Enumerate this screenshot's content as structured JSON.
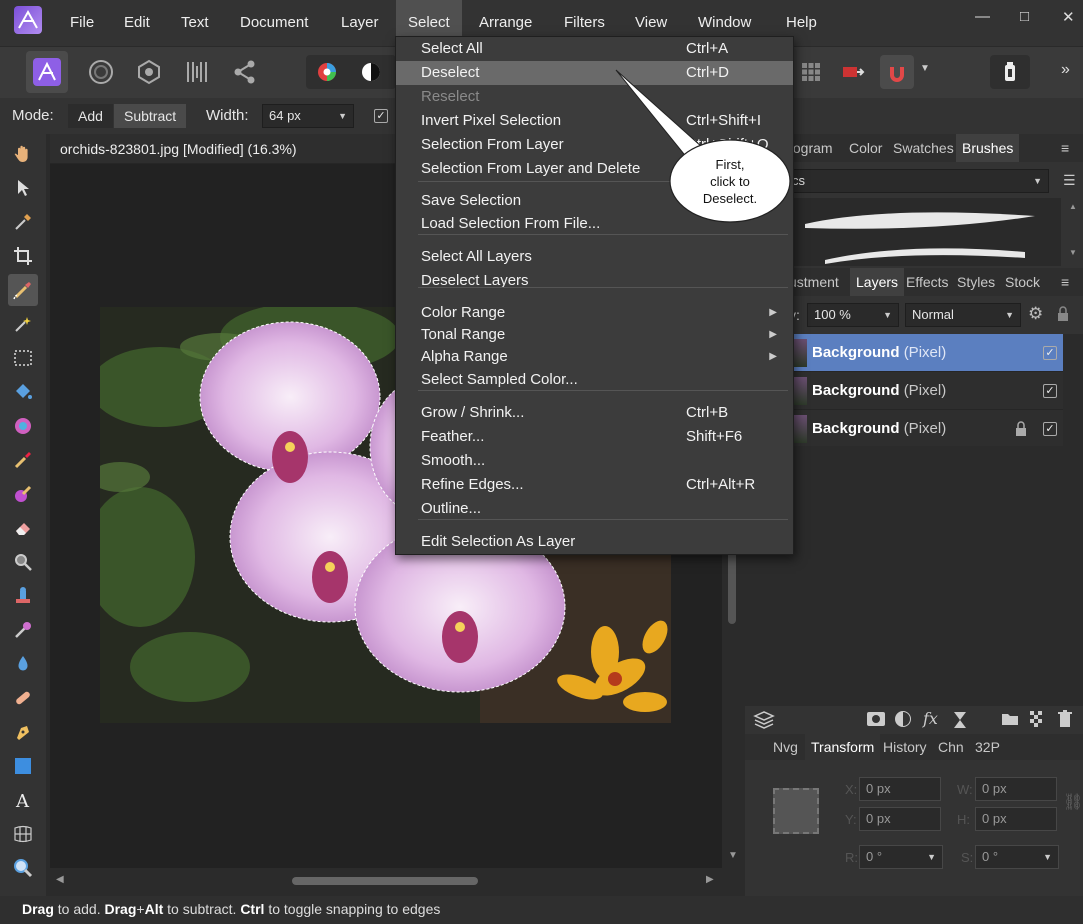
{
  "menubar": {
    "items": [
      "File",
      "Edit",
      "Text",
      "Document",
      "Layer",
      "Select",
      "Arrange",
      "Filters",
      "View",
      "Window",
      "Help"
    ],
    "active": "Select",
    "window_controls": {
      "minimize": "—",
      "maximize": "□",
      "close": "✕"
    }
  },
  "toolbar": {
    "more_label": "»"
  },
  "context_bar": {
    "mode_label": "Mode:",
    "mode_add": "Add",
    "mode_subtract": "Subtract",
    "width_label": "Width:",
    "width_value": "64 px",
    "checkbox_mark": "✓"
  },
  "document": {
    "tab_title": "orchids-823801.jpg [Modified] (16.3%)"
  },
  "select_menu": {
    "groups": [
      [
        {
          "label": "Select All",
          "shortcut": "Ctrl+A"
        },
        {
          "label": "Deselect",
          "shortcut": "Ctrl+D",
          "highlighted": true
        },
        {
          "label": "Reselect",
          "shortcut": "",
          "disabled": true
        },
        {
          "label": "Invert Pixel Selection",
          "shortcut": "Ctrl+Shift+I"
        },
        {
          "label": "Selection From Layer",
          "shortcut": "Ctrl+Shift+O"
        },
        {
          "label": "Selection From Layer and Delete",
          "shortcut": ""
        }
      ],
      [
        {
          "label": "Save Selection",
          "shortcut": ""
        },
        {
          "label": "Load Selection From File...",
          "shortcut": ""
        }
      ],
      [
        {
          "label": "Select All Layers",
          "shortcut": ""
        },
        {
          "label": "Deselect Layers",
          "shortcut": ""
        }
      ],
      [
        {
          "label": "Color Range",
          "submenu": true
        },
        {
          "label": "Tonal Range",
          "submenu": true
        },
        {
          "label": "Alpha Range",
          "submenu": true
        },
        {
          "label": "Select Sampled Color...",
          "shortcut": ""
        }
      ],
      [
        {
          "label": "Grow / Shrink...",
          "shortcut": "Ctrl+B"
        },
        {
          "label": "Feather...",
          "shortcut": "Shift+F6"
        },
        {
          "label": "Smooth...",
          "shortcut": ""
        },
        {
          "label": "Refine Edges...",
          "shortcut": "Ctrl+Alt+R"
        },
        {
          "label": "Outline...",
          "shortcut": ""
        }
      ],
      [
        {
          "label": "Edit Selection As Layer",
          "shortcut": ""
        }
      ]
    ]
  },
  "callout": {
    "line1": "First,",
    "line2": "click to",
    "line3": "Deselect."
  },
  "panel_top": {
    "tabs": [
      "togram",
      "Color",
      "Swatches",
      "Brushes"
    ],
    "active_tab": "Brushes",
    "category_value": "cs"
  },
  "panel_layers": {
    "tabs": [
      "ustment",
      "Layers",
      "Effects",
      "Styles",
      "Stock"
    ],
    "active_tab": "Layers",
    "opacity_label": "y:",
    "opacity_value": "100 %",
    "blend_mode": "Normal",
    "layers": [
      {
        "name": "Background",
        "type": "(Pixel)",
        "selected": true,
        "locked": false
      },
      {
        "name": "Background",
        "type": "(Pixel)",
        "selected": false,
        "locked": false
      },
      {
        "name": "Background",
        "type": "(Pixel)",
        "selected": false,
        "locked": true
      }
    ]
  },
  "panel_transform": {
    "tabs": [
      "Nvg",
      "Transform",
      "History",
      "Chn",
      "32P"
    ],
    "active_tab": "Transform",
    "x_label": "X:",
    "x_value": "0 px",
    "y_label": "Y:",
    "y_value": "0 px",
    "w_label": "W:",
    "w_value": "0 px",
    "h_label": "H:",
    "h_value": "0 px",
    "r_label": "R:",
    "r_value": "0 °",
    "s_label": "S:",
    "s_value": "0 °"
  },
  "status": {
    "b1": "Drag",
    "t1": " to add. ",
    "b2": "Drag",
    "t2": "+",
    "b3": "Alt",
    "t3": " to subtract. ",
    "b4": "Ctrl",
    "t4": " to toggle snapping to edges"
  },
  "colors": {
    "accent": "#5b7fc0",
    "menu_highlight": "#6a6a6a",
    "app_bg": "#2b2b2b",
    "brand": "#8e5fe6"
  }
}
